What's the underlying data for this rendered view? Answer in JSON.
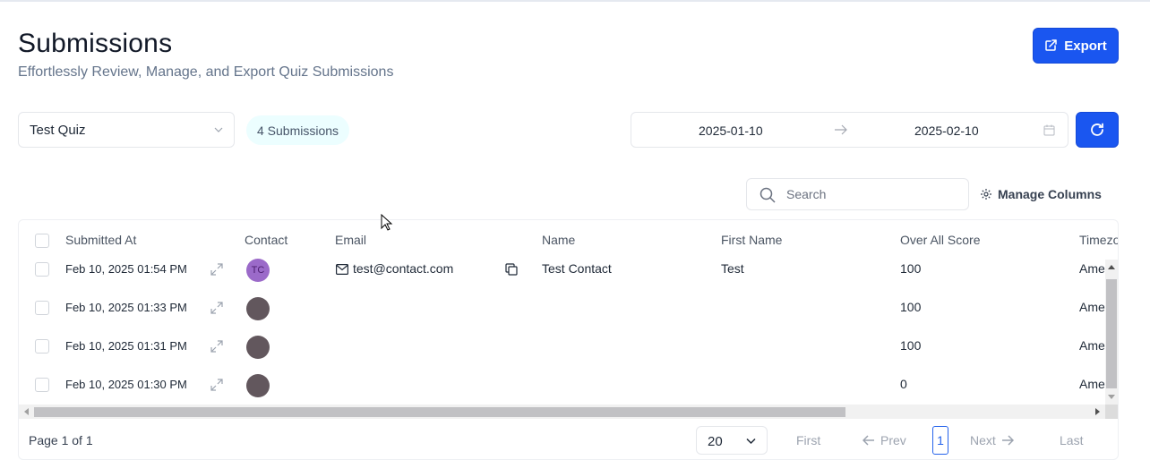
{
  "header": {
    "title": "Submissions",
    "subtitle": "Effortlessly Review, Manage, and Export Quiz Submissions",
    "export_label": "Export"
  },
  "filters": {
    "quiz_select": "Test Quiz",
    "submissions_badge": "4 Submissions",
    "date_from": "2025-01-10",
    "date_to": "2025-02-10"
  },
  "toolbar": {
    "search_placeholder": "Search",
    "manage_columns_label": "Manage Columns"
  },
  "table": {
    "columns": [
      "Submitted At",
      "Contact",
      "Email",
      "Name",
      "First Name",
      "Over All Score",
      "Timezo"
    ],
    "rows": [
      {
        "submitted_at": "Feb 10, 2025 01:54 PM",
        "avatar_initials": "TC",
        "email": "test@contact.com",
        "name": "Test Contact",
        "first_name": "Test",
        "score": "100",
        "timezone": "Ame"
      },
      {
        "submitted_at": "Feb 10, 2025 01:33 PM",
        "avatar_initials": "",
        "email": "",
        "name": "",
        "first_name": "",
        "score": "100",
        "timezone": "Ame"
      },
      {
        "submitted_at": "Feb 10, 2025 01:31 PM",
        "avatar_initials": "",
        "email": "",
        "name": "",
        "first_name": "",
        "score": "100",
        "timezone": "Ame"
      },
      {
        "submitted_at": "Feb 10, 2025 01:30 PM",
        "avatar_initials": "",
        "email": "",
        "name": "",
        "first_name": "",
        "score": "0",
        "timezone": "Ame"
      }
    ]
  },
  "pagination": {
    "page_info": "Page 1 of 1",
    "page_size": "20",
    "first": "First",
    "prev": "Prev",
    "current": "1",
    "next": "Next",
    "last": "Last"
  },
  "colors": {
    "accent": "#1a56f0",
    "avatar_contact": "#9b6ac9",
    "avatar_empty": "#62575d",
    "badge_bg": "#ecfeff"
  },
  "icons": {
    "export": "export-icon",
    "refresh": "refresh-icon",
    "search": "search-icon",
    "manage": "gear-icon",
    "expand": "expand-icon",
    "mail": "mail-icon",
    "copy": "copy-icon"
  }
}
